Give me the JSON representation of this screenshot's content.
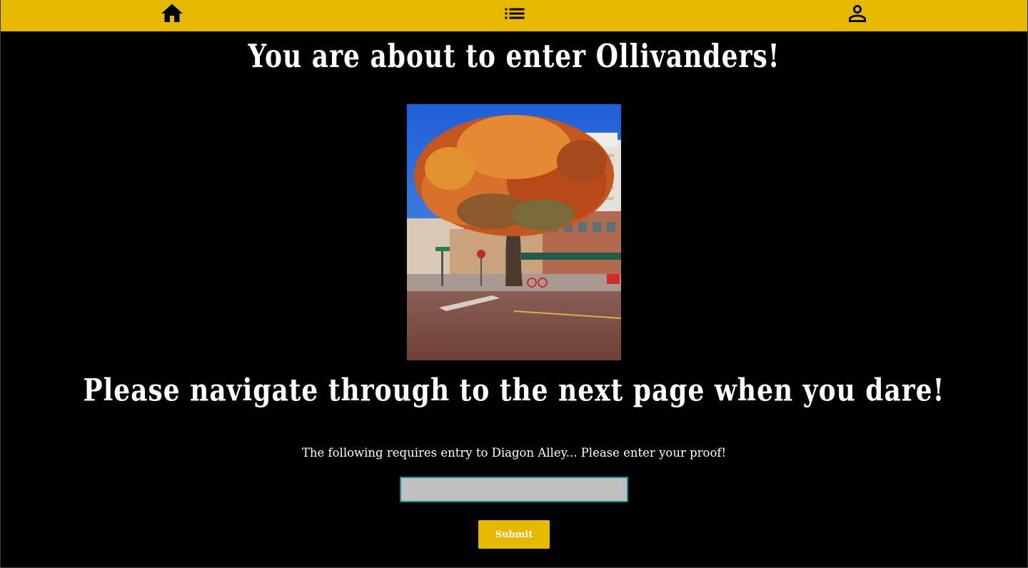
{
  "nav": {
    "home_icon": "home-icon",
    "list_icon": "list-icon",
    "profile_icon": "person-icon"
  },
  "heading": {
    "title": "You are about to enter Ollivanders!",
    "subtitle": "Please navigate through to the next page when you dare!"
  },
  "image": {
    "alt": "Street corner with a large autumn tree"
  },
  "form": {
    "prompt": "The following requires entry to Diagon Alley... Please enter your proof!",
    "proof_value": "",
    "submit_label": "Submit"
  },
  "colors": {
    "accent": "#e6b900",
    "background": "#000000",
    "input_bg": "#c0c0c0",
    "input_border": "#1a8a8a"
  }
}
